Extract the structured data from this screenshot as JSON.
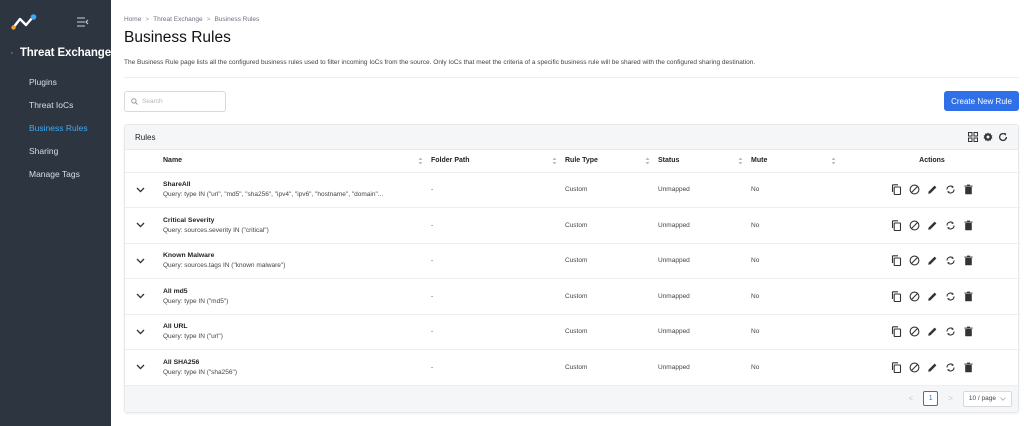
{
  "sidebar": {
    "back_label": "Threat Exchange",
    "items": [
      {
        "label": "Plugins",
        "active": false
      },
      {
        "label": "Threat IoCs",
        "active": false
      },
      {
        "label": "Business Rules",
        "active": true
      },
      {
        "label": "Sharing",
        "active": false
      },
      {
        "label": "Manage Tags",
        "active": false
      }
    ]
  },
  "breadcrumb": [
    "Home",
    "Threat Exchange",
    "Business Rules"
  ],
  "page": {
    "title": "Business Rules",
    "description": "The Business Rule page lists all the configured business rules used to filter incoming IoCs from the source. Only IoCs that meet the criteria of a specific business rule will be shared with the configured sharing destination."
  },
  "search": {
    "placeholder": "Search",
    "value": ""
  },
  "create_button": "Create New Rule",
  "card": {
    "title": "Rules"
  },
  "table": {
    "columns": [
      "Name",
      "Folder Path",
      "Rule Type",
      "Status",
      "Mute",
      "Actions"
    ],
    "rows": [
      {
        "name": "ShareAll",
        "query": "Query: type IN (\"url\", \"md5\", \"sha256\", \"ipv4\", \"ipv6\", \"hostname\", \"domain\"...",
        "folder": "-",
        "type": "Custom",
        "status": "Unmapped",
        "mute": "No"
      },
      {
        "name": "Critical Severity",
        "query": "Query: sources.severity IN (\"critical\")",
        "folder": "-",
        "type": "Custom",
        "status": "Unmapped",
        "mute": "No"
      },
      {
        "name": "Known Malware",
        "query": "Query: sources.tags IN (\"known malware\")",
        "folder": "-",
        "type": "Custom",
        "status": "Unmapped",
        "mute": "No"
      },
      {
        "name": "All md5",
        "query": "Query: type IN (\"md5\")",
        "folder": "-",
        "type": "Custom",
        "status": "Unmapped",
        "mute": "No"
      },
      {
        "name": "All URL",
        "query": "Query: type IN (\"url\")",
        "folder": "-",
        "type": "Custom",
        "status": "Unmapped",
        "mute": "No"
      },
      {
        "name": "All SHA256",
        "query": "Query: type IN (\"sha256\")",
        "folder": "-",
        "type": "Custom",
        "status": "Unmapped",
        "mute": "No"
      }
    ]
  },
  "pagination": {
    "prev": "<",
    "page": "1",
    "next": ">",
    "page_size": "10 / page"
  },
  "colors": {
    "sidebar_bg": "#2d3640",
    "accent": "#2f6fe8",
    "active_nav": "#3fa9f5"
  }
}
